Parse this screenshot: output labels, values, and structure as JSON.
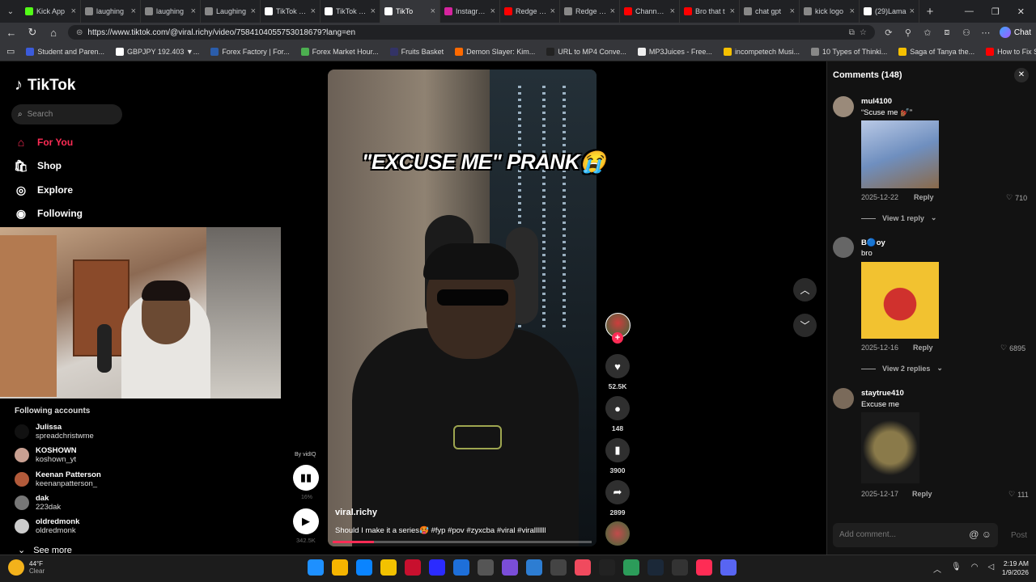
{
  "browser": {
    "tabs": [
      {
        "label": "Kick App",
        "color": "#53fc18",
        "active": false
      },
      {
        "label": "laughing",
        "color": "#888888",
        "active": false
      },
      {
        "label": "laughing",
        "color": "#888888",
        "active": false
      },
      {
        "label": "Laughing",
        "color": "#888888",
        "active": false
      },
      {
        "label": "TikTok Stu",
        "color": "#ffffff",
        "active": false
      },
      {
        "label": "TikTok Stu",
        "color": "#ffffff",
        "active": false
      },
      {
        "label": "TikTo",
        "color": "#ffffff",
        "active": true
      },
      {
        "label": "Instagram",
        "color": "#d6249f",
        "active": false
      },
      {
        "label": "Redge - Yo",
        "color": "#ff0000",
        "active": false
      },
      {
        "label": "Redge @R",
        "color": "#888888",
        "active": false
      },
      {
        "label": "Channel c",
        "color": "#ff0000",
        "active": false
      },
      {
        "label": "Bro that t",
        "color": "#ff0000",
        "active": false
      },
      {
        "label": "chat gpt",
        "color": "#888888",
        "active": false
      },
      {
        "label": "kick logo",
        "color": "#888888",
        "active": false
      },
      {
        "label": "(29)Lama",
        "color": "#ffffff",
        "active": false
      }
    ],
    "url": "https://www.tiktok.com/@viral.richy/video/7584104055753018679?lang=en",
    "chat_label": "Chat",
    "bookmarks": [
      {
        "label": "Student and Paren...",
        "color": "#3b5bdb"
      },
      {
        "label": "GBPJPY 192.403 ▼...",
        "color": "#ffffff"
      },
      {
        "label": "Forex Factory | For...",
        "color": "#2b5dab"
      },
      {
        "label": "Forex Market Hour...",
        "color": "#4caf50"
      },
      {
        "label": "Fruits Basket",
        "color": "#333366"
      },
      {
        "label": "Demon Slayer: Kim...",
        "color": "#ff6a00"
      },
      {
        "label": "URL to MP4 Conve...",
        "color": "#222222"
      },
      {
        "label": "MP3Juices - Free...",
        "color": "#eeeeee"
      },
      {
        "label": "incompetech Musi...",
        "color": "#f5c000"
      },
      {
        "label": "10 Types of Thinki...",
        "color": "#888888"
      },
      {
        "label": "Saga of Tanya the...",
        "color": "#f5c000"
      },
      {
        "label": "How to Fix Screen...",
        "color": "#ff0000"
      }
    ]
  },
  "sidebar": {
    "brand": "TikTok",
    "search_placeholder": "Search",
    "nav": [
      {
        "label": "For You",
        "icon": "home-icon",
        "active": true
      },
      {
        "label": "Shop",
        "icon": "shop-bag-icon",
        "active": false
      },
      {
        "label": "Explore",
        "icon": "compass-icon",
        "active": false
      },
      {
        "label": "Following",
        "icon": "following-avatar-icon",
        "active": false
      }
    ],
    "following_header": "Following accounts",
    "following": [
      {
        "name": "Julissa",
        "handle": "spreadchristwme",
        "color": "#111111"
      },
      {
        "name": "KOSHOWN",
        "handle": "koshown_yt",
        "color": "#c9a092"
      },
      {
        "name": "Keenan Patterson",
        "handle": "keenanpatterson_",
        "color": "#b25a3a"
      },
      {
        "name": "dak",
        "handle": "223dak",
        "color": "#777777"
      },
      {
        "name": "oldredmonk",
        "handle": "oldredmonk",
        "color": "#cccccc"
      }
    ],
    "see_more": "See more"
  },
  "video": {
    "overlay_text": "\"EXCUSE ME\" PRANK😭",
    "username": "viral.richy",
    "caption": "Should I make it a series🥵 #fyp #pov #zyxcba #viral #viralllllll",
    "progress": 0.16
  },
  "actions": {
    "likes": "52.5K",
    "comments": "148",
    "saves": "3900",
    "shares": "2899"
  },
  "vidiq": {
    "label": "By vidIQ",
    "stat1": "16%",
    "stat2": "342.5K"
  },
  "comments": {
    "header": "Comments (148)",
    "items": [
      {
        "user": "mul4100",
        "text": "“Scuse me 💅🏾”",
        "date": "2025-12-22",
        "likes": "710",
        "replies": "View 1 reply",
        "avatar": "#9a8a7a"
      },
      {
        "user": "B🔵oy",
        "text": "bro",
        "date": "2025-12-16",
        "likes": "6895",
        "replies": "View 2 replies",
        "avatar": "#666666"
      },
      {
        "user": "staytrue410",
        "text": "Excuse me",
        "date": "2025-12-17",
        "likes": "111",
        "replies": "",
        "avatar": "#7a6a5a"
      }
    ],
    "reply_label": "Reply",
    "input_placeholder": "Add comment...",
    "post_label": "Post"
  },
  "taskbar": {
    "temp": "44°F",
    "condition": "Clear",
    "time": "2:19 AM",
    "date": "1/9/2026",
    "icons": [
      "#1e90ff",
      "#f5b400",
      "#0a84ff",
      "#f2c200",
      "#c8102e",
      "#2b2bff",
      "#1e6fd9",
      "#555555",
      "#7a4dd8",
      "#2d7dd2",
      "#444444",
      "#f04a5e",
      "#222222",
      "#2c9c5a",
      "#1b2838",
      "#333333",
      "#fe2c55",
      "#5865f2"
    ]
  }
}
